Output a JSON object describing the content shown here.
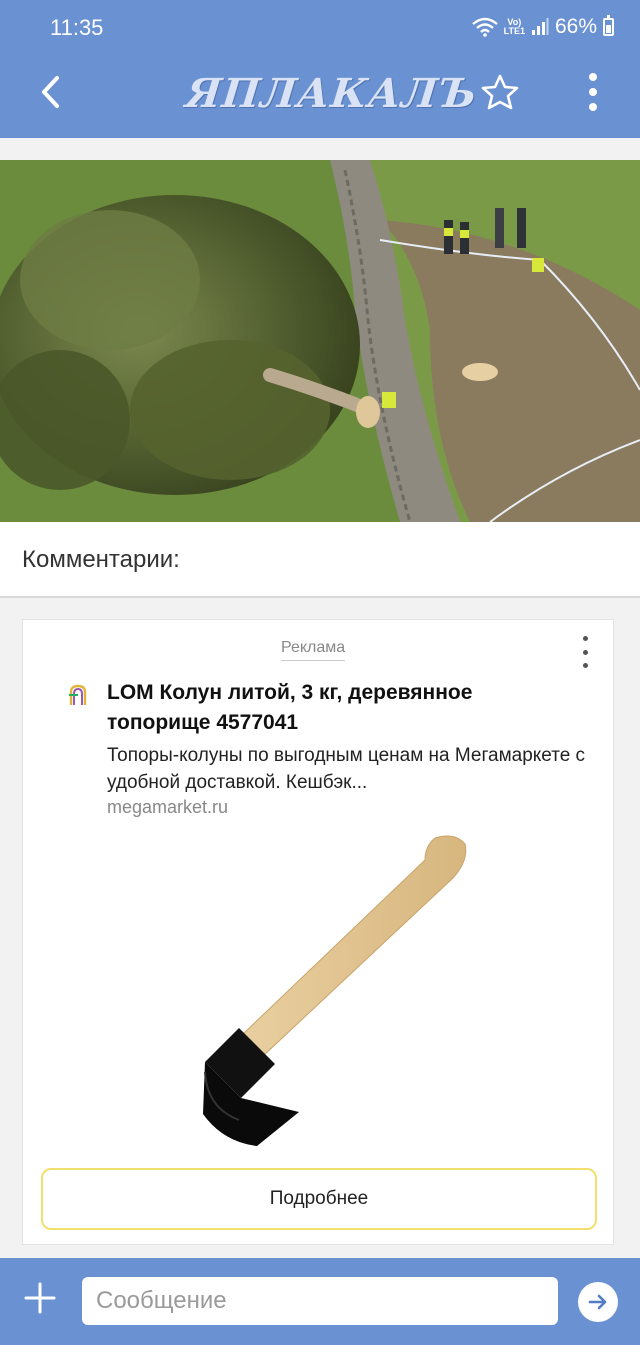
{
  "status_bar": {
    "time": "11:35",
    "network_line1": "Vo)",
    "network_line2": "LTE1",
    "battery_percent": "66%"
  },
  "header": {
    "logo_text": "ЯПЛАКАЛЪ",
    "icons": [
      "back-icon",
      "star-icon",
      "more-vertical-icon"
    ]
  },
  "photo": {
    "subject": "felled tree on a stone wall"
  },
  "comments": {
    "title": "Комментарии:"
  },
  "ad": {
    "label": "Реклама",
    "title": "LOM Колун литой, 3 кг, деревянное топорище 4577041",
    "description": "Топоры-колуны по выгодным ценам на Мегамаркете с удобной доставкой. Кешбэк...",
    "domain": "megamarket.ru",
    "button_label": "Подробнее"
  },
  "message_bar": {
    "placeholder": "Сообщение"
  },
  "colors": {
    "header_bg": "#6a91d2",
    "ad_button_border": "#f3e06c"
  }
}
